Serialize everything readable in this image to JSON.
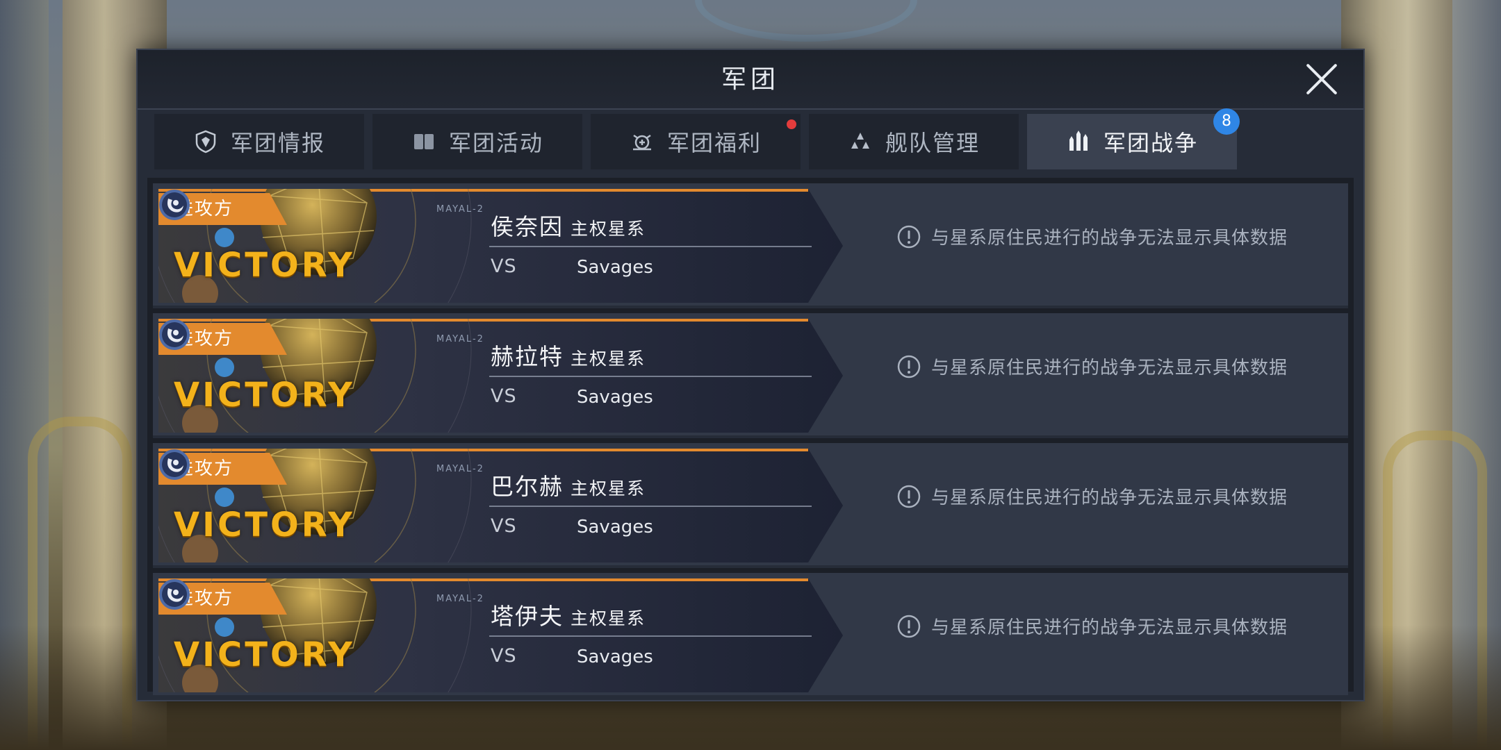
{
  "dialog": {
    "title": "军团",
    "close_icon": "close-icon"
  },
  "tabs": [
    {
      "label": "军团情报",
      "icon": "shield-icon",
      "active": false,
      "dot": false
    },
    {
      "label": "军团活动",
      "icon": "book-icon",
      "active": false,
      "dot": false
    },
    {
      "label": "军团福利",
      "icon": "gift-icon",
      "active": false,
      "dot": true
    },
    {
      "label": "舰队管理",
      "icon": "fleet-icon",
      "active": false,
      "dot": false
    },
    {
      "label": "军团战争",
      "icon": "war-icon",
      "active": true,
      "badge": "8"
    }
  ],
  "wars": [
    {
      "role": "进攻方",
      "result": "VICTORY",
      "planet": "MAYAL-2",
      "system": "侯奈因",
      "system_suffix": "主权星系",
      "vs": "VS",
      "enemy": "Savages",
      "info": "与星系原住民进行的战争无法显示具体数据"
    },
    {
      "role": "进攻方",
      "result": "VICTORY",
      "planet": "MAYAL-2",
      "system": "赫拉特",
      "system_suffix": "主权星系",
      "vs": "VS",
      "enemy": "Savages",
      "info": "与星系原住民进行的战争无法显示具体数据"
    },
    {
      "role": "进攻方",
      "result": "VICTORY",
      "planet": "MAYAL-2",
      "system": "巴尔赫",
      "system_suffix": "主权星系",
      "vs": "VS",
      "enemy": "Savages",
      "info": "与星系原住民进行的战争无法显示具体数据"
    },
    {
      "role": "进攻方",
      "result": "VICTORY",
      "planet": "MAYAL-2",
      "system": "塔伊夫",
      "system_suffix": "主权星系",
      "vs": "VS",
      "enemy": "Savages",
      "info": "与星系原住民进行的战争无法显示具体数据"
    }
  ],
  "colors": {
    "accent_orange": "#e38a2e",
    "victory_gold": "#f3b21b",
    "badge_blue": "#2f86e6",
    "notify_red": "#e33c3c",
    "panel_bg": "#262c38"
  }
}
